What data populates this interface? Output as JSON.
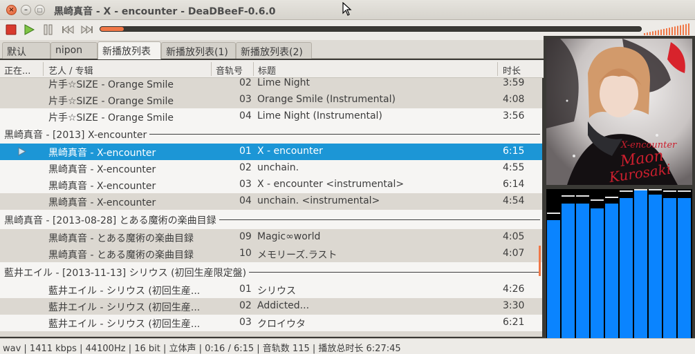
{
  "window": {
    "title": "黒崎真音 - X - encounter - DeaDBeeF-0.6.0"
  },
  "toolbar": {
    "seek_progress": 0.043,
    "volume_level": 1.0
  },
  "tabs": [
    {
      "label": "默认",
      "active": false
    },
    {
      "label": "nipon",
      "active": false
    },
    {
      "label": "新播放列表",
      "active": true
    },
    {
      "label": "新播放列表(1)",
      "active": false
    },
    {
      "label": "新播放列表(2)",
      "active": false
    }
  ],
  "columns": {
    "status": "正在...",
    "artist_album": "艺人 / 专辑",
    "track": "音轨号",
    "title": "标题",
    "duration": "时长"
  },
  "playlist": {
    "rows_a": [
      {
        "artist": "片手☆SIZE - Orange Smile",
        "track": "02",
        "title": "Lime Night",
        "duration": "3:59"
      },
      {
        "artist": "片手☆SIZE - Orange Smile",
        "track": "03",
        "title": "Orange Smile (Instrumental)",
        "duration": "4:08"
      },
      {
        "artist": "片手☆SIZE - Orange Smile",
        "track": "04",
        "title": "Lime Night (Instrumental)",
        "duration": "3:56"
      }
    ],
    "group_1": "黒崎真音 - [2013] X-encounter",
    "rows_b": [
      {
        "artist": "黒崎真音 - X-encounter",
        "track": "01",
        "title": "X - encounter",
        "duration": "6:15",
        "playing": true
      },
      {
        "artist": "黒崎真音 - X-encounter",
        "track": "02",
        "title": "unchain.",
        "duration": "4:55"
      },
      {
        "artist": "黒崎真音 - X-encounter",
        "track": "03",
        "title": "X - encounter <instrumental>",
        "duration": "6:14"
      },
      {
        "artist": "黒崎真音 - X-encounter",
        "track": "04",
        "title": "unchain. <instrumental>",
        "duration": "4:54"
      }
    ],
    "group_2": "黒崎真音 - [2013-08-28] とある魔術の楽曲目録",
    "rows_c": [
      {
        "artist": "黒崎真音 - とある魔術の楽曲目録",
        "track": "09",
        "title": "Magic∞world",
        "duration": "4:05"
      },
      {
        "artist": "黒崎真音 - とある魔術の楽曲目録",
        "track": "10",
        "title": "メモリーズ.ラスト",
        "duration": "4:07"
      }
    ],
    "group_3": "藍井エイル - [2013-11-13] シリウス (初回生産限定盤)",
    "rows_d": [
      {
        "artist": "藍井エイル - シリウス (初回生産...",
        "track": "01",
        "title": "シリウス",
        "duration": "4:26"
      },
      {
        "artist": "藍井エイル - シリウス (初回生産...",
        "track": "02",
        "title": "Addicted...",
        "duration": "3:30"
      },
      {
        "artist": "藍井エイル - シリウス (初回生産...",
        "track": "03",
        "title": "クロイウタ",
        "duration": "6:21"
      }
    ]
  },
  "cover": {
    "art_text_1": "X-encounter",
    "art_text_2": "Maon",
    "art_text_3": "Kurosaki"
  },
  "spectrum": {
    "bar_color": "#0a84ff",
    "levels": [
      0.8,
      0.91,
      0.91,
      0.88,
      0.91,
      0.95,
      1.0,
      0.97,
      0.95,
      0.95
    ],
    "peaks": [
      0.83,
      0.95,
      0.95,
      0.92,
      0.94,
      0.98,
      1.0,
      1.0,
      0.98,
      0.98
    ]
  },
  "status": {
    "text": "wav | 1411 kbps | 44100Hz | 16 bit | 立体声 | 0:16 / 6:15 | 音轨数 115 | 播放总时长 6:27:45"
  },
  "colors": {
    "accent": "#f07746",
    "selection": "#1c96d6"
  }
}
